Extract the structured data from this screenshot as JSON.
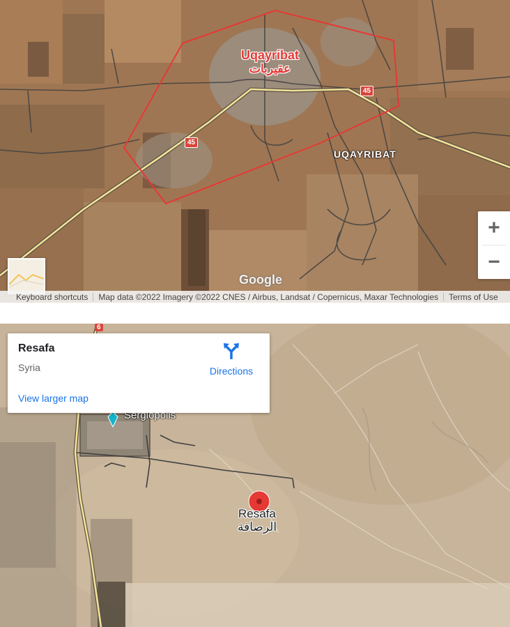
{
  "top_map": {
    "city_label_latin": "Uqayribat",
    "city_label_arabic": "عقيربات",
    "district_label": "UQAYRIBAT",
    "road_shield_a": "45",
    "road_shield_b": "45",
    "logo": "Google",
    "zoom_in": "+",
    "zoom_out": "−",
    "attribution": {
      "shortcuts": "Keyboard shortcuts",
      "map_data": "Map data ©2022 Imagery ©2022 CNES / Airbus, Landsat / Copernicus, Maxar Technologies",
      "terms": "Terms of Use"
    },
    "colors": {
      "boundary": "#e53935",
      "road_major": "#f6e79a",
      "shield": "#d8453b"
    }
  },
  "bottom_map": {
    "info_card": {
      "place_name": "Resafa",
      "address": "Syria",
      "directions_label": "Directions",
      "view_larger": "View larger map"
    },
    "road_shield": "6",
    "poi_label": "Sergiopolis",
    "marker_label_latin": "Resafa",
    "marker_label_arabic": "الرصافة",
    "colors": {
      "marker": "#e53935",
      "poi": "#12b5cb",
      "link": "#1a73e8"
    }
  }
}
